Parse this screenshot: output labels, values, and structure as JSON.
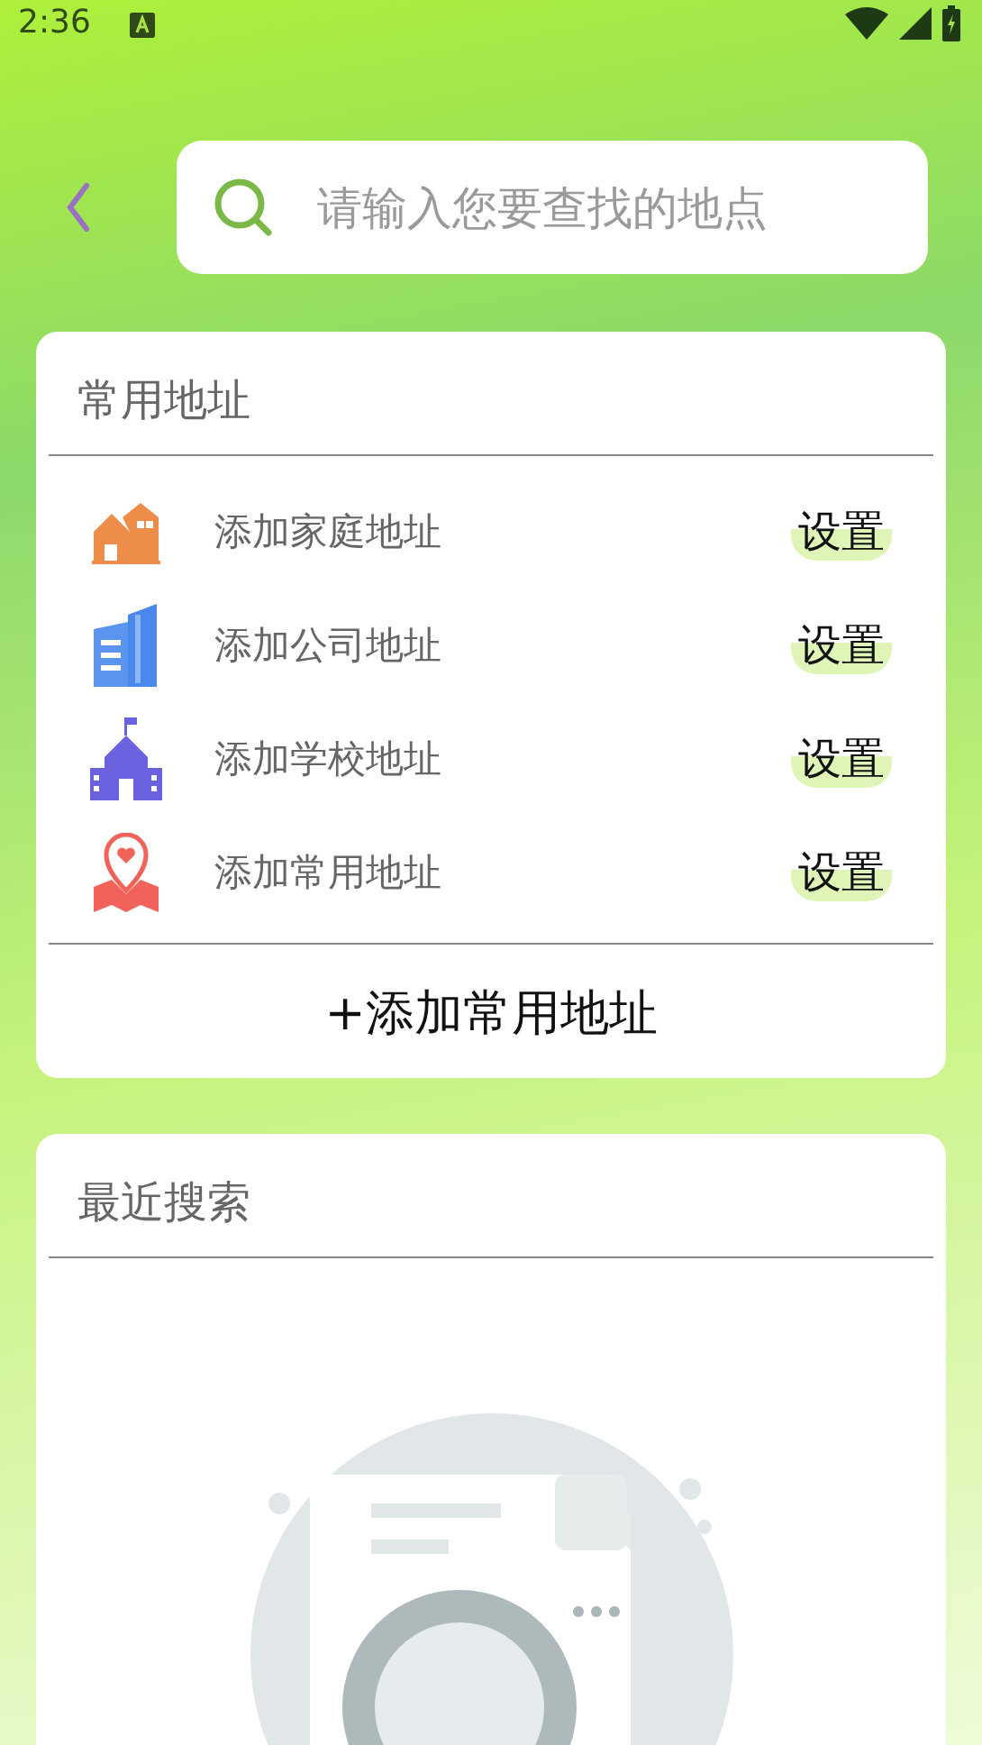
{
  "status_bar": {
    "time": "2:36"
  },
  "search": {
    "placeholder": "请输入您要查找的地点"
  },
  "common_addresses": {
    "title": "常用地址",
    "items": [
      {
        "kind": "home",
        "label": "添加家庭地址",
        "action": "设置"
      },
      {
        "kind": "office",
        "label": "添加公司地址",
        "action": "设置"
      },
      {
        "kind": "school",
        "label": "添加学校地址",
        "action": "设置"
      },
      {
        "kind": "pin",
        "label": "添加常用地址",
        "action": "设置"
      }
    ],
    "add_button": "+添加常用地址"
  },
  "recent": {
    "title": "最近搜索"
  }
}
